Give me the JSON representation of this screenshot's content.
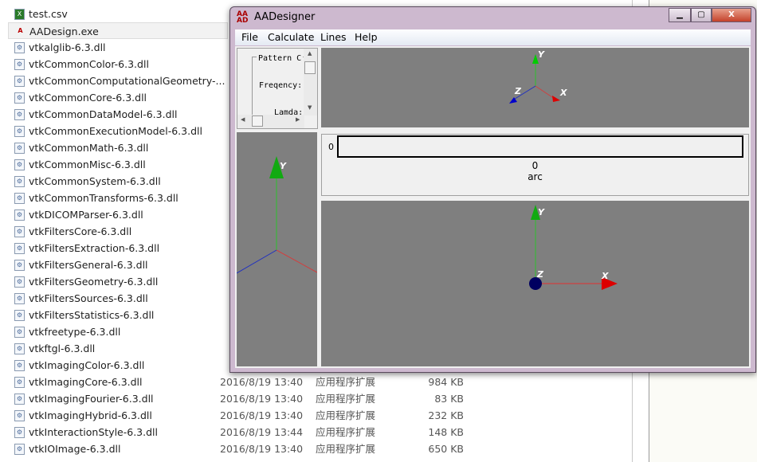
{
  "files": [
    {
      "name": "test.csv",
      "icon": "csv-file-icon"
    },
    {
      "name": "AADesign.exe",
      "icon": "exe-app-icon",
      "selected": true
    },
    {
      "name": "vtkalglib-6.3.dll"
    },
    {
      "name": "vtkCommonColor-6.3.dll"
    },
    {
      "name": "vtkCommonComputationalGeometry-..."
    },
    {
      "name": "vtkCommonCore-6.3.dll"
    },
    {
      "name": "vtkCommonDataModel-6.3.dll"
    },
    {
      "name": "vtkCommonExecutionModel-6.3.dll"
    },
    {
      "name": "vtkCommonMath-6.3.dll"
    },
    {
      "name": "vtkCommonMisc-6.3.dll"
    },
    {
      "name": "vtkCommonSystem-6.3.dll"
    },
    {
      "name": "vtkCommonTransforms-6.3.dll"
    },
    {
      "name": "vtkDICOMParser-6.3.dll"
    },
    {
      "name": "vtkFiltersCore-6.3.dll"
    },
    {
      "name": "vtkFiltersExtraction-6.3.dll"
    },
    {
      "name": "vtkFiltersGeneral-6.3.dll"
    },
    {
      "name": "vtkFiltersGeometry-6.3.dll"
    },
    {
      "name": "vtkFiltersSources-6.3.dll"
    },
    {
      "name": "vtkFiltersStatistics-6.3.dll"
    },
    {
      "name": "vtkfreetype-6.3.dll"
    },
    {
      "name": "vtkftgl-6.3.dll"
    },
    {
      "name": "vtkImagingColor-6.3.dll"
    },
    {
      "name": "vtkImagingCore-6.3.dll",
      "date": "2016/8/19 13:40",
      "type": "应用程序扩展",
      "size": "984 KB"
    },
    {
      "name": "vtkImagingFourier-6.3.dll",
      "date": "2016/8/19 13:40",
      "type": "应用程序扩展",
      "size": "83 KB"
    },
    {
      "name": "vtkImagingHybrid-6.3.dll",
      "date": "2016/8/19 13:40",
      "type": "应用程序扩展",
      "size": "232 KB"
    },
    {
      "name": "vtkInteractionStyle-6.3.dll",
      "date": "2016/8/19 13:44",
      "type": "应用程序扩展",
      "size": "148 KB"
    },
    {
      "name": "vtkIOImage-6.3.dll",
      "date": "2016/8/19 13:40",
      "type": "应用程序扩展",
      "size": "650 KB"
    }
  ],
  "window": {
    "title": "AADesigner",
    "menu": [
      "File",
      "Calculate",
      "Lines",
      "Help"
    ],
    "params": {
      "pattern": "Pattern C",
      "frequency": "Freqency:",
      "lambda": "Lamda:"
    },
    "slider": {
      "min_label": "0",
      "value": "0",
      "unit": "arc"
    },
    "axes": {
      "x": "X",
      "y": "Y",
      "z": "Z"
    }
  }
}
